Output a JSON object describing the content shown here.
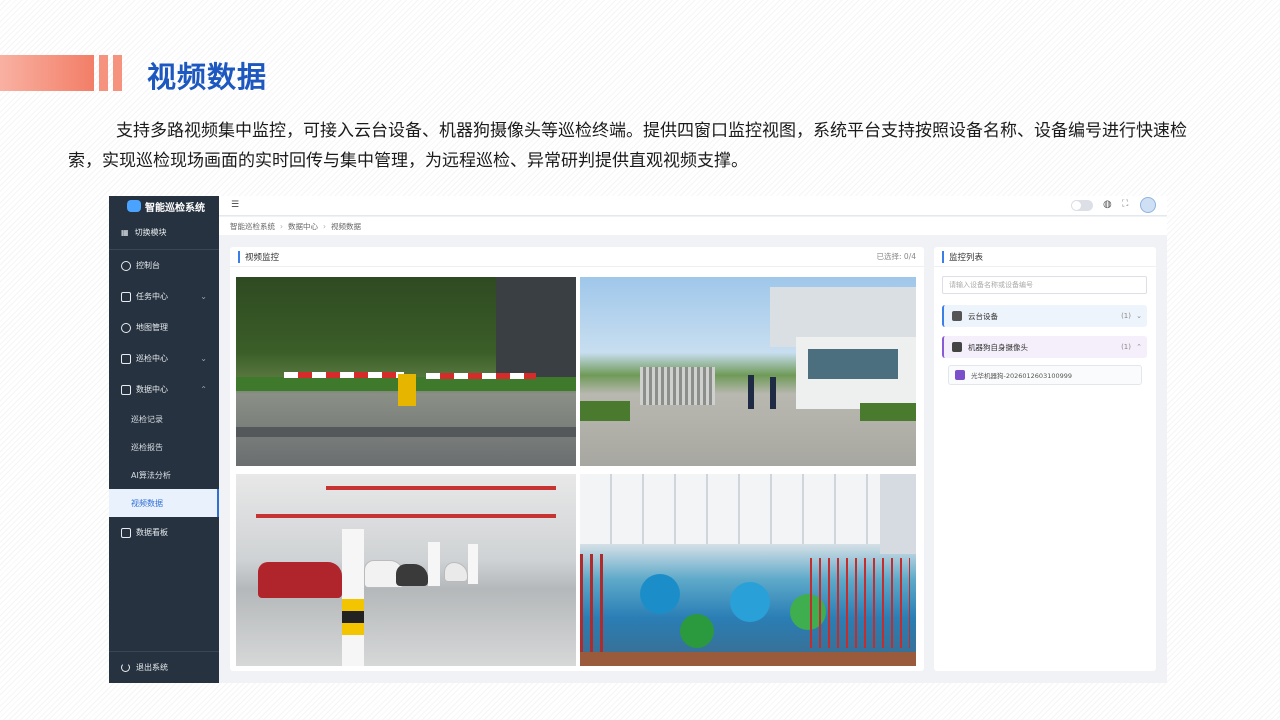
{
  "slide": {
    "title": "视频数据",
    "intro": "支持多路视频集中监控，可接入云台设备、机器狗摄像头等巡检终端。提供四窗口监控视图，系统平台支持按照设备名称、设备编号进行快速检索，实现巡检现场画面的实时回传与集中管理，为远程巡检、异常研判提供直观视频支撑。",
    "accent_color": "#f27e67",
    "title_color": "#1d58c0"
  },
  "app": {
    "sidebar": {
      "logo": "智能巡检系统",
      "switch_label": "切换模块",
      "items": [
        {
          "label": "控制台",
          "icon": "dashboard-icon"
        },
        {
          "label": "任务中心",
          "icon": "calendar-icon",
          "chevron": "⌄"
        },
        {
          "label": "地图管理",
          "icon": "map-icon"
        },
        {
          "label": "巡检中心",
          "icon": "clipboard-icon",
          "chevron": "⌄"
        },
        {
          "label": "数据中心",
          "icon": "data-icon",
          "chevron": "⌃"
        }
      ],
      "sub_items": [
        "巡检记录",
        "巡检报告",
        "AI算法分析",
        "视频数据"
      ],
      "extra_item": {
        "label": "数据看板",
        "icon": "monitor-icon"
      },
      "logout": "退出系统"
    },
    "breadcrumb": [
      "智能巡检系统",
      "数据中心",
      "视频数据"
    ],
    "video_panel": {
      "title": "视频监控",
      "selected": "已选择: 0/4"
    },
    "list_panel": {
      "title": "监控列表",
      "search_placeholder": "请输入设备名称或设备编号",
      "groups": [
        {
          "label": "云台设备",
          "count": "(1)",
          "arrow": "⌄"
        },
        {
          "label": "机器狗自身摄像头",
          "count": "(1)",
          "arrow": "⌃"
        }
      ],
      "device": "光华机器狗-2026012603100999"
    },
    "active_color": "#2f6fd6"
  }
}
